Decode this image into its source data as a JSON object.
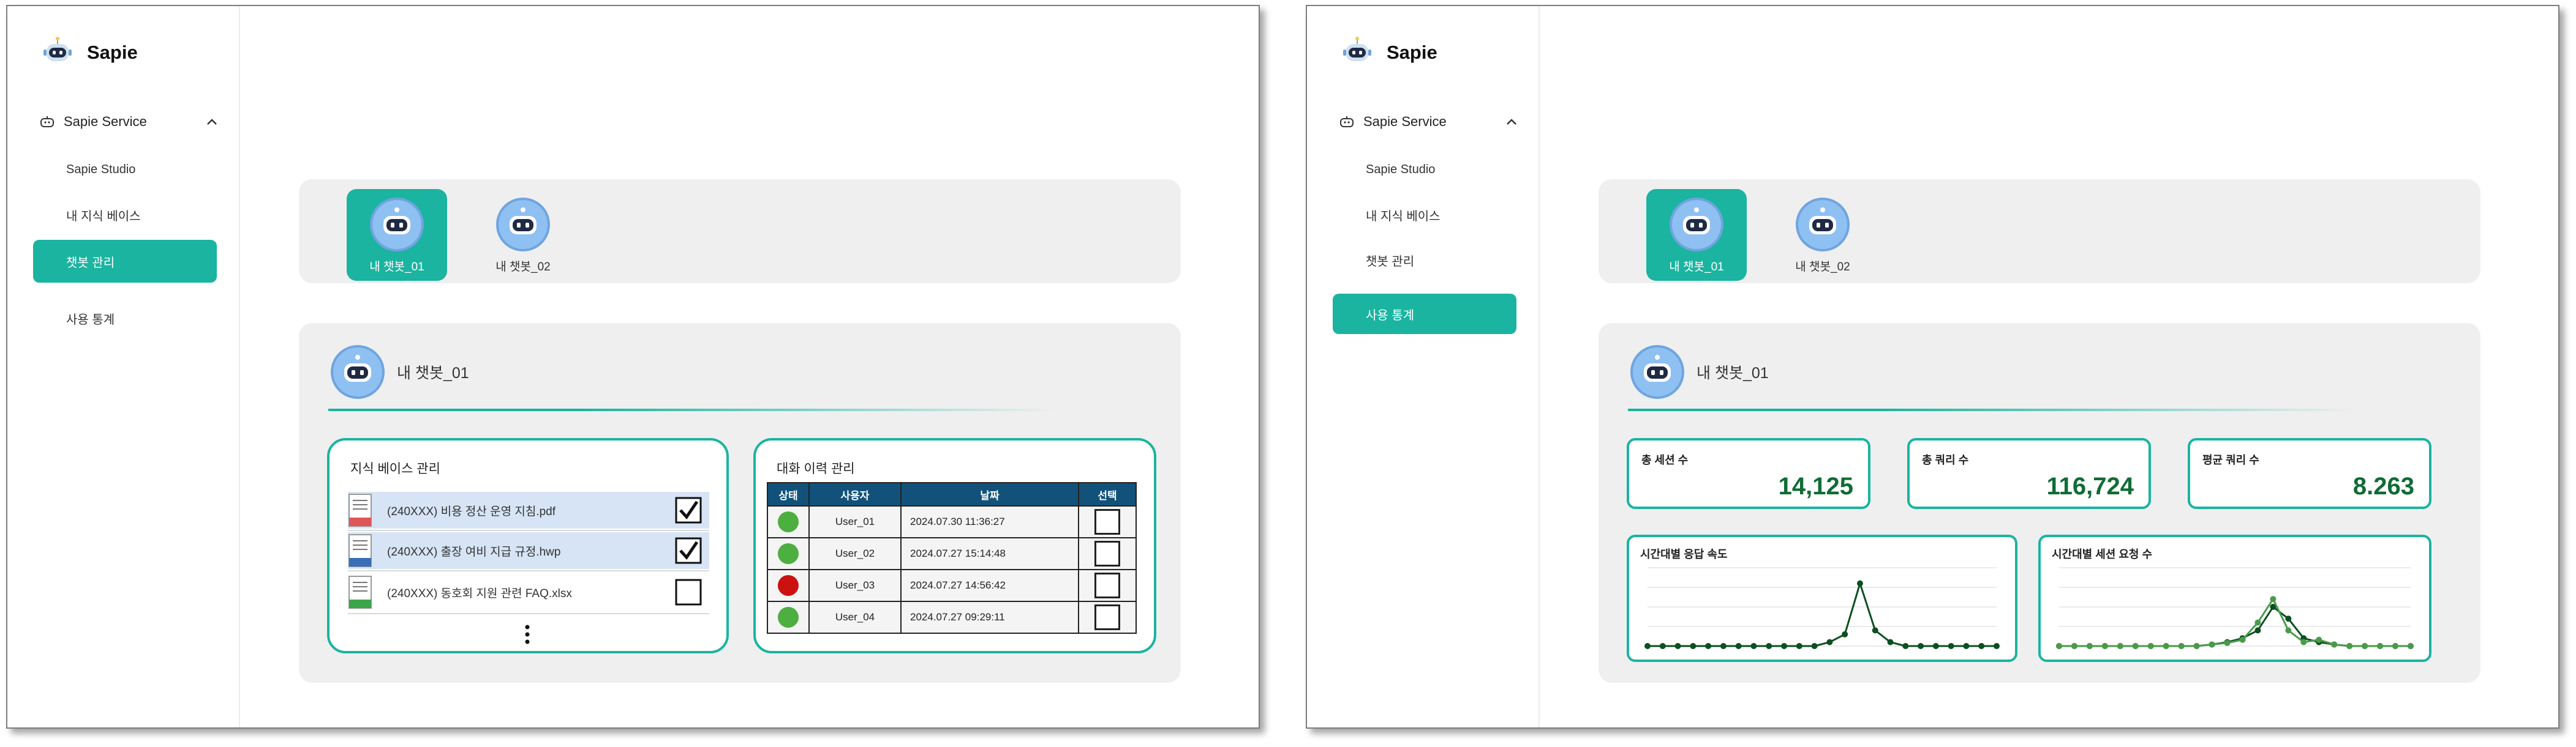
{
  "brand": {
    "name": "Sapie"
  },
  "sidebar": {
    "service_label": "Sapie Service",
    "items": [
      {
        "label": "Sapie Studio"
      },
      {
        "label": "내 지식 베이스"
      },
      {
        "label": "챗봇 관리"
      },
      {
        "label": "사용 통계"
      }
    ]
  },
  "bots": [
    {
      "label": "내 챗봇_01"
    },
    {
      "label": "내 챗봇_02"
    }
  ],
  "panel": {
    "title": "내 챗봇_01"
  },
  "knowledge": {
    "title": "지식 베이스 관리",
    "files": [
      {
        "name": "(240XXX) 비용 정산 운영 지침.pdf",
        "checked": true,
        "color": "#e05656"
      },
      {
        "name": "(240XXX) 출장 여비 지급 규정.hwp",
        "checked": true,
        "color": "#3a6fb5"
      },
      {
        "name": "(240XXX) 동호회 지원 관련 FAQ.xlsx",
        "checked": false,
        "color": "#3aa54a"
      }
    ]
  },
  "history": {
    "title": "대화 이력 관리",
    "headers": [
      "상태",
      "사용자",
      "날짜",
      "선택"
    ],
    "rows": [
      {
        "status": "green",
        "user": "User_01",
        "date": "2024.07.30  11:36:27"
      },
      {
        "status": "green",
        "user": "User_02",
        "date": "2024.07.27  15:14:48"
      },
      {
        "status": "red",
        "user": "User_03",
        "date": "2024.07.27  14:56:42"
      },
      {
        "status": "green",
        "user": "User_04",
        "date": "2024.07.27  09:29:11"
      }
    ]
  },
  "stats": [
    {
      "label": "총 세션 수",
      "value": "14,125"
    },
    {
      "label": "총 쿼리 수",
      "value": "116,724"
    },
    {
      "label": "평균 쿼리 수",
      "value": "8.263"
    }
  ],
  "colors": {
    "accent": "#1ab4a0",
    "value_green": "#0f6c35",
    "table_header": "#12527a",
    "status_green": "#4caf3f",
    "status_red": "#cc1111"
  },
  "chart_data": [
    {
      "type": "line",
      "title": "시간대별 응답 속도",
      "x": [
        0,
        1,
        2,
        3,
        4,
        5,
        6,
        7,
        8,
        9,
        10,
        11,
        12,
        13,
        14,
        15,
        16,
        17,
        18,
        19,
        20,
        21,
        22,
        23
      ],
      "series": [
        {
          "values": [
            0,
            0,
            0,
            0,
            0,
            0,
            0,
            0,
            0,
            0,
            0,
            0,
            0.05,
            0.15,
            0.8,
            0.2,
            0.05,
            0,
            0,
            0,
            0,
            0,
            0,
            0
          ]
        }
      ],
      "ylim": [
        0,
        1
      ]
    },
    {
      "type": "line",
      "title": "시간대별 세션 요청 수",
      "x": [
        0,
        1,
        2,
        3,
        4,
        5,
        6,
        7,
        8,
        9,
        10,
        11,
        12,
        13,
        14,
        15,
        16,
        17,
        18,
        19,
        20,
        21,
        22,
        23
      ],
      "series": [
        {
          "values": [
            0,
            0,
            0,
            0,
            0,
            0,
            0,
            0,
            0,
            0,
            0.02,
            0.05,
            0.1,
            0.2,
            0.5,
            0.35,
            0.1,
            0.05,
            0.02,
            0,
            0,
            0,
            0,
            0
          ]
        },
        {
          "values": [
            0,
            0,
            0,
            0,
            0,
            0,
            0,
            0,
            0,
            0,
            0.02,
            0.04,
            0.08,
            0.3,
            0.6,
            0.2,
            0.05,
            0.08,
            0.02,
            0,
            0,
            0,
            0,
            0
          ]
        }
      ],
      "ylim": [
        0,
        1
      ]
    }
  ]
}
